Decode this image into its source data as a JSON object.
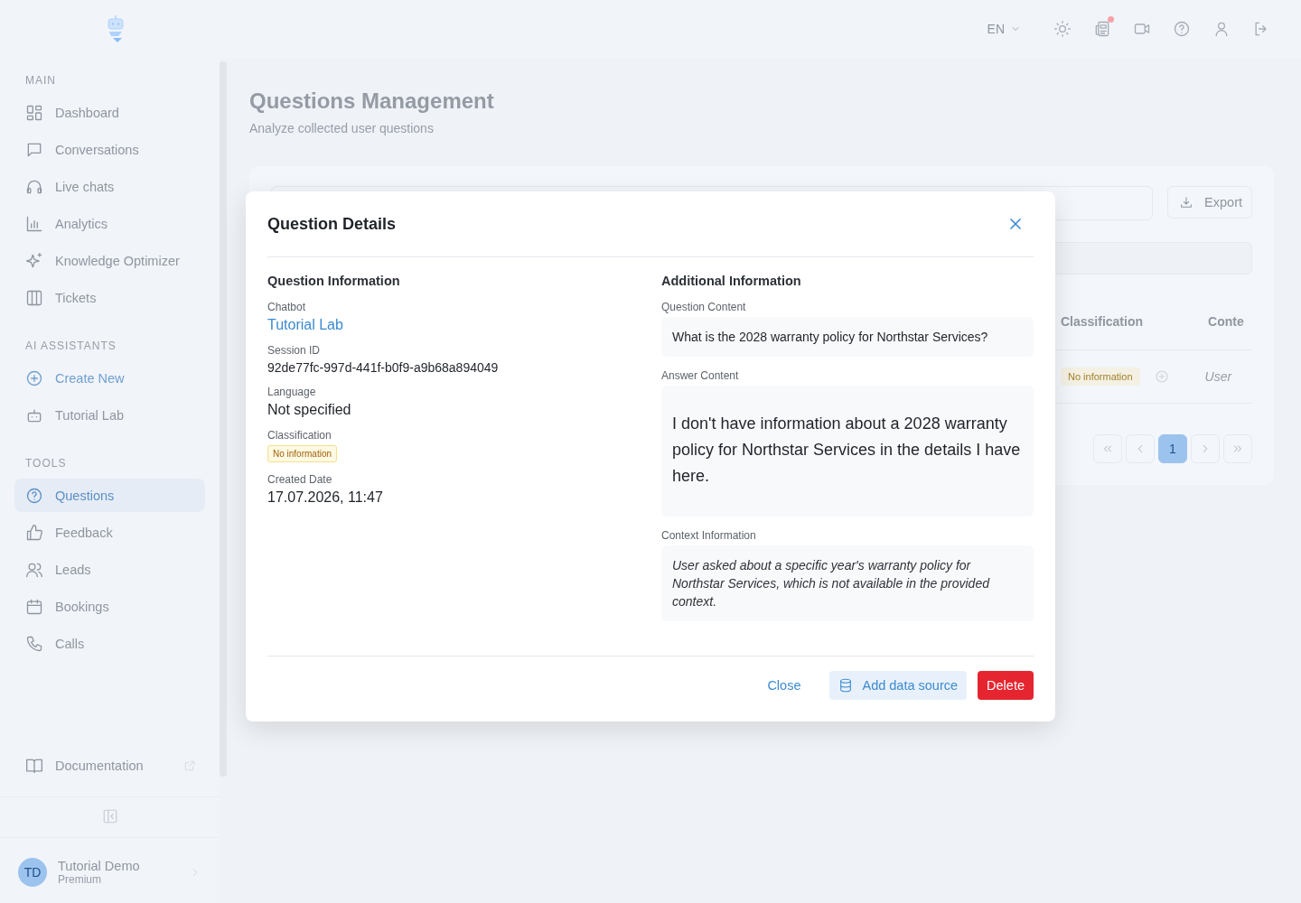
{
  "topbar": {
    "language": "EN",
    "notifications_unread": true
  },
  "sidebar": {
    "sections": [
      {
        "title": "MAIN",
        "items": [
          {
            "label": "Dashboard",
            "kind": "link",
            "selected": false
          },
          {
            "label": "Conversations",
            "kind": "link",
            "selected": false
          },
          {
            "label": "Live chats",
            "kind": "link",
            "selected": false
          },
          {
            "label": "Analytics",
            "kind": "link",
            "selected": false
          },
          {
            "label": "Knowledge Optimizer",
            "kind": "link",
            "selected": false
          },
          {
            "label": "Tickets",
            "kind": "link",
            "selected": false
          }
        ]
      },
      {
        "title": "AI ASSISTANTS",
        "items": [
          {
            "label": "Create New",
            "kind": "action",
            "selected": false
          },
          {
            "label": "Tutorial Lab",
            "kind": "link",
            "selected": false
          }
        ]
      },
      {
        "title": "TOOLS",
        "items": [
          {
            "label": "Questions",
            "kind": "link",
            "selected": true
          },
          {
            "label": "Feedback",
            "kind": "link",
            "selected": false
          },
          {
            "label": "Leads",
            "kind": "link",
            "selected": false
          },
          {
            "label": "Bookings",
            "kind": "link",
            "selected": false
          },
          {
            "label": "Calls",
            "kind": "link",
            "selected": false
          }
        ]
      }
    ],
    "documentation": "Documentation",
    "user": {
      "initials": "TD",
      "name": "Tutorial Demo",
      "plan": "Premium"
    }
  },
  "page": {
    "title": "Questions Management",
    "subtitle": "Analyze collected user questions",
    "export_button": "Export",
    "table": {
      "columns": [
        "Classification",
        "Conte"
      ],
      "rows": [
        {
          "classification": "No information",
          "context": "User"
        }
      ]
    },
    "pagination": {
      "pages": [
        {
          "label": "1",
          "selected": true
        }
      ]
    }
  },
  "dialog": {
    "title": "Question Details",
    "left": {
      "heading": "Question Information",
      "fields": [
        {
          "label": "Chatbot",
          "value": "Tutorial Lab",
          "kind": "link"
        },
        {
          "label": "Session ID",
          "value": "92de77fc-997d-441f-b0f9-a9b68a894049",
          "kind": "mono"
        },
        {
          "label": "Language",
          "value": "Not specified",
          "kind": "text"
        },
        {
          "label": "Classification",
          "value": "No information",
          "kind": "badge"
        },
        {
          "label": "Created Date",
          "value": "17.07.2026, 11:47",
          "kind": "text"
        }
      ]
    },
    "right": {
      "heading": "Additional Information",
      "fields": [
        {
          "label": "Question Content",
          "value": "What is the 2028 warranty policy for Northstar Services?",
          "kind": "plain"
        },
        {
          "label": "Answer Content",
          "value": "I don't have information about a 2028 warranty policy for Northstar Services in the details I have here.",
          "kind": "large"
        },
        {
          "label": "Context Information",
          "value": "User asked about a specific year's warranty policy for Northstar Services, which is not available in the provided context.",
          "kind": "italic"
        }
      ]
    },
    "buttons": [
      {
        "label": "Close",
        "kind": "text"
      },
      {
        "label": "Add data source",
        "kind": "secondary"
      },
      {
        "label": "Delete",
        "kind": "danger"
      }
    ]
  }
}
